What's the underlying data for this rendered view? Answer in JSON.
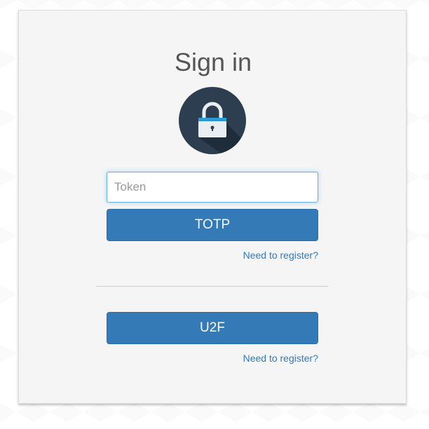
{
  "page": {
    "title": "Sign in"
  },
  "icons": {
    "lock": "lock-icon"
  },
  "totp": {
    "input_value": "",
    "input_placeholder": "Token",
    "button_label": "TOTP",
    "register_link": "Need to register?"
  },
  "u2f": {
    "button_label": "U2F",
    "register_link": "Need to register?"
  },
  "colors": {
    "primary": "#337ab7",
    "card_bg": "#f5f5f5",
    "lock_circle": "#2c3e50"
  }
}
